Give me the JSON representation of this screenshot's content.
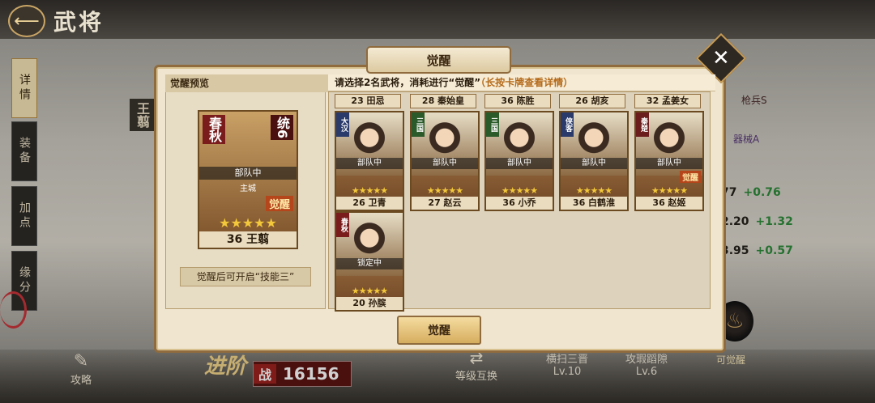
{
  "header": {
    "title": "武将",
    "back_icon": "back-arrow-icon"
  },
  "side_tabs": [
    {
      "label": "详情",
      "active": true
    },
    {
      "label": "装备",
      "active": false
    },
    {
      "label": "加点",
      "active": false
    },
    {
      "label": "缘分",
      "active": false
    }
  ],
  "hero_label": "王翦",
  "right_stats": {
    "weapon_a": "枪兵S",
    "weapon_b": "器械A",
    "rows": [
      {
        "value": "77",
        "plus": "+0.76"
      },
      {
        "value": "2.20",
        "plus": "+1.32"
      },
      {
        "value": "3.95",
        "plus": "+0.57"
      }
    ]
  },
  "bottom": {
    "strategy": "攻略",
    "advance": "进阶",
    "power_label": "战",
    "power_value": "16156",
    "level_swap": "等级互换",
    "sweep": {
      "title": "横扫三晋",
      "level": "Lv.10"
    },
    "breach": {
      "title": "攻瑕蹈隙",
      "level": "Lv.6"
    },
    "can_awaken": "可觉醒"
  },
  "modal": {
    "title": "觉醒",
    "close_icon": "close-x-icon",
    "preview_title": "觉醒预览",
    "preview_card": {
      "faction": "春秋",
      "tong": "统6",
      "status": "部队中",
      "city": "主城",
      "awaken": "觉醒",
      "stars": "★★★★★",
      "level_name": "36 王翦"
    },
    "skill_hint": "觉醒后可开启“技能三”",
    "instruction_main": "请选择2名武将，消耗进行“觉醒”",
    "instruction_hint": "（长按卡牌查看详情）",
    "top_row": [
      "23 田忌",
      "28 秦始皇",
      "36 陈胜",
      "26 胡亥",
      "32 孟姜女"
    ],
    "cards": [
      {
        "faction": "大汉",
        "ftype": "xia",
        "status": "部队中",
        "stars": "★★★★★",
        "name": "26 卫青",
        "awaken": ""
      },
      {
        "faction": "三国",
        "ftype": "sanguo",
        "status": "部队中",
        "stars": "★★★★★",
        "name": "27 赵云",
        "awaken": ""
      },
      {
        "faction": "三国",
        "ftype": "sanguo",
        "status": "部队中",
        "stars": "★★★★★",
        "name": "36 小乔",
        "awaken": ""
      },
      {
        "faction": "侠客",
        "ftype": "xia",
        "status": "部队中",
        "stars": "★★★★★",
        "name": "36 白鹤淮",
        "awaken": ""
      },
      {
        "faction": "秦楚",
        "ftype": "qinhan",
        "status": "部队中",
        "stars": "★★★★★",
        "name": "36 赵姬",
        "awaken": "觉醒"
      },
      {
        "faction": "春秋",
        "ftype": "chunqiu",
        "status": "锁定中",
        "stars": "★★★★★",
        "name": "20 孙膑",
        "awaken": ""
      }
    ],
    "confirm_button": "觉醒"
  }
}
